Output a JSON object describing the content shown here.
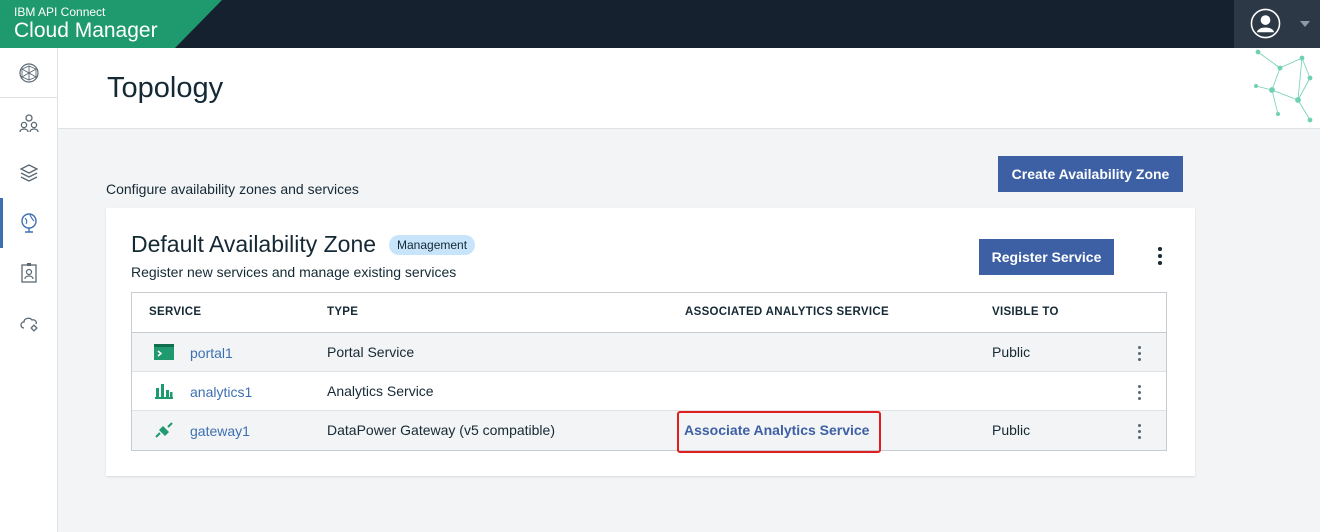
{
  "app": {
    "product_line": "IBM API Connect",
    "product_name": "Cloud Manager"
  },
  "sidebar": {
    "items": [
      {
        "icon": "globe-network-icon",
        "active": false
      },
      {
        "icon": "members-icon",
        "active": false
      },
      {
        "icon": "layers-icon",
        "active": false
      },
      {
        "icon": "topology-globe-icon",
        "active": true
      },
      {
        "icon": "badge-id-icon",
        "active": false
      },
      {
        "icon": "cloud-settings-icon",
        "active": false
      }
    ]
  },
  "page": {
    "title": "Topology",
    "subtitle": "Configure availability zones and services",
    "create_zone_label": "Create Availability Zone"
  },
  "zone": {
    "title": "Default Availability Zone",
    "badge": "Management",
    "description": "Register new services and manage existing services",
    "register_label": "Register Service"
  },
  "table": {
    "headers": {
      "service": "SERVICE",
      "type": "TYPE",
      "analytics": "ASSOCIATED ANALYTICS SERVICE",
      "visible": "VISIBLE TO"
    },
    "rows": [
      {
        "icon": "portal-icon",
        "name": "portal1",
        "type": "Portal Service",
        "analytics": "",
        "visible": "Public"
      },
      {
        "icon": "analytics-icon",
        "name": "analytics1",
        "type": "Analytics Service",
        "analytics": "",
        "visible": ""
      },
      {
        "icon": "gateway-icon",
        "name": "gateway1",
        "type": "DataPower Gateway (v5 compatible)",
        "analytics": "Associate Analytics Service",
        "visible": "Public"
      }
    ]
  },
  "colors": {
    "brand": "#1e9a6e",
    "header": "#162130",
    "primary_button": "#3d60a5",
    "link": "#3d70b2",
    "highlight": "#e02020"
  }
}
